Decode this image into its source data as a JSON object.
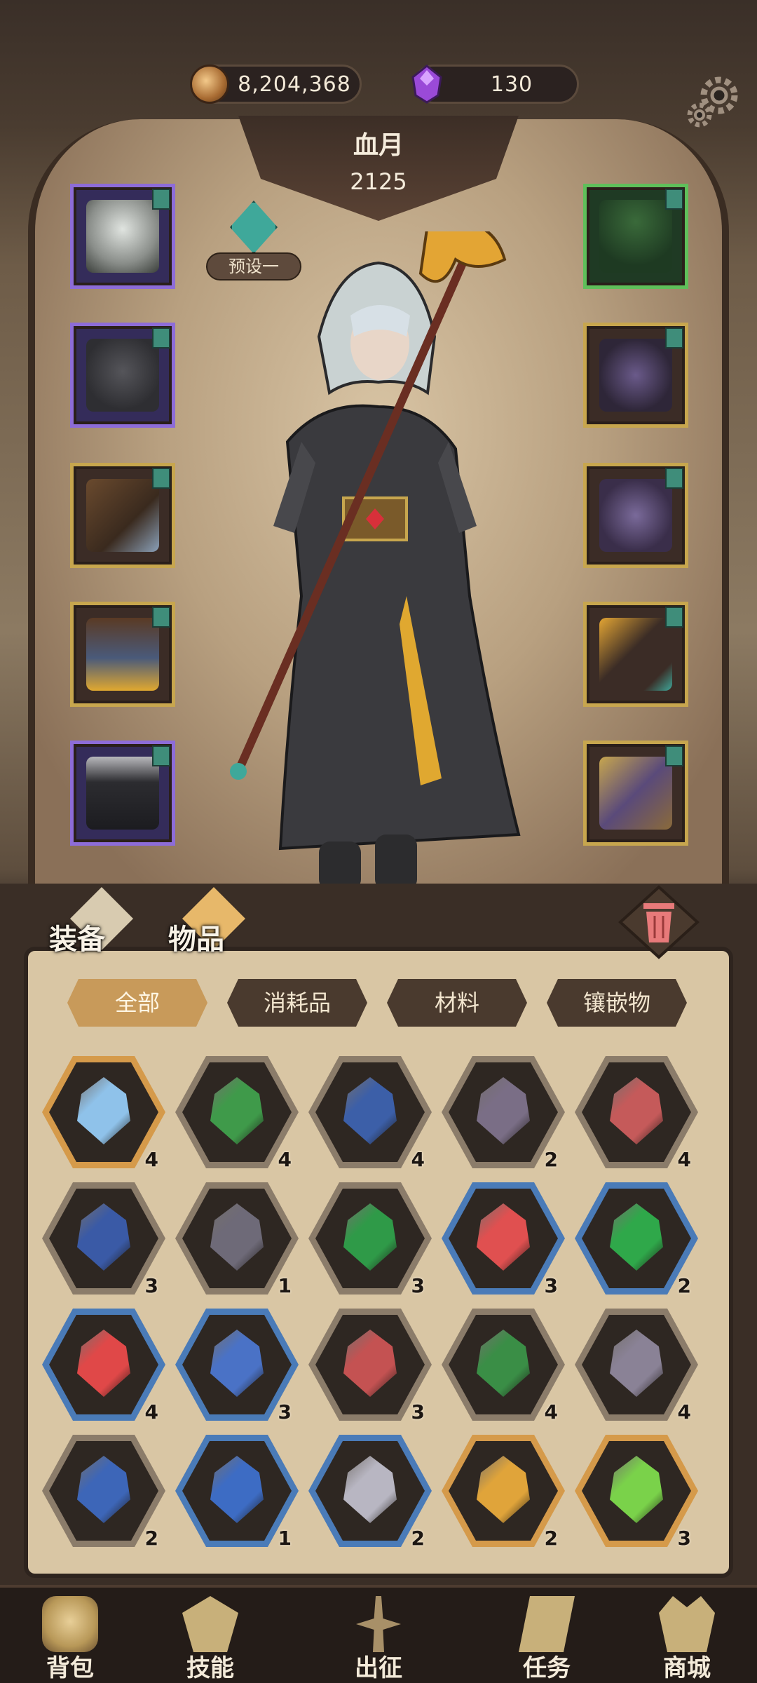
{
  "currency": {
    "gold": "8,204,368",
    "gems": "130"
  },
  "character": {
    "name": "血月",
    "power": "2125",
    "preset_label": "预设一"
  },
  "equipment": {
    "left": [
      {
        "name": "hood",
        "rarity": "purple"
      },
      {
        "name": "robe",
        "rarity": "purple"
      },
      {
        "name": "gloves",
        "rarity": "gold"
      },
      {
        "name": "belt-skirt",
        "rarity": "gold"
      },
      {
        "name": "boots",
        "rarity": "purple"
      }
    ],
    "right": [
      {
        "name": "necklace",
        "rarity": "green"
      },
      {
        "name": "shoulder-armor",
        "rarity": "gold"
      },
      {
        "name": "fur-cape",
        "rarity": "gold"
      },
      {
        "name": "staff",
        "rarity": "gold"
      },
      {
        "name": "spellbook",
        "rarity": "gold"
      }
    ]
  },
  "inventory_tabs": {
    "equipment": "装备",
    "items": "物品"
  },
  "filters": [
    "全部",
    "消耗品",
    "材料",
    "镶嵌物"
  ],
  "active_filter": 0,
  "items": [
    {
      "color": "#8fc2ea",
      "frame": "orange",
      "qty": "4"
    },
    {
      "color": "#3f9a4a",
      "frame": "gray",
      "qty": "4"
    },
    {
      "color": "#3c5fa8",
      "frame": "gray",
      "qty": "4"
    },
    {
      "color": "#7a6e86",
      "frame": "gray",
      "qty": "2"
    },
    {
      "color": "#c55a5a",
      "frame": "gray",
      "qty": "4"
    },
    {
      "color": "#3a5aa6",
      "frame": "gray",
      "qty": "3"
    },
    {
      "color": "#6e6a78",
      "frame": "gray",
      "qty": "1"
    },
    {
      "color": "#2f9a48",
      "frame": "gray",
      "qty": "3"
    },
    {
      "color": "#e05050",
      "frame": "blue",
      "qty": "3"
    },
    {
      "color": "#2fa84a",
      "frame": "blue",
      "qty": "2"
    },
    {
      "color": "#e04848",
      "frame": "blue",
      "qty": "4"
    },
    {
      "color": "#4a72c6",
      "frame": "blue",
      "qty": "3"
    },
    {
      "color": "#c45252",
      "frame": "gray",
      "qty": "3"
    },
    {
      "color": "#3a8e46",
      "frame": "gray",
      "qty": "4"
    },
    {
      "color": "#8a8296",
      "frame": "gray",
      "qty": "4"
    },
    {
      "color": "#3d66b8",
      "frame": "gray",
      "qty": "2"
    },
    {
      "color": "#3d6cc4",
      "frame": "blue",
      "qty": "1"
    },
    {
      "color": "#b8b6c2",
      "frame": "blue",
      "qty": "2"
    },
    {
      "color": "#e0a43a",
      "frame": "orange",
      "qty": "2"
    },
    {
      "color": "#7ad24a",
      "frame": "orange",
      "qty": "3"
    }
  ],
  "nav": [
    "背包",
    "技能",
    "出征",
    "任务",
    "商城"
  ],
  "colors": {
    "accent_gold": "#c7a64e",
    "purple_rarity": "#8d6cd8",
    "green_rarity": "#5fbf5a",
    "blue_frame": "#4a7bb8",
    "orange_frame": "#d59a4a"
  }
}
